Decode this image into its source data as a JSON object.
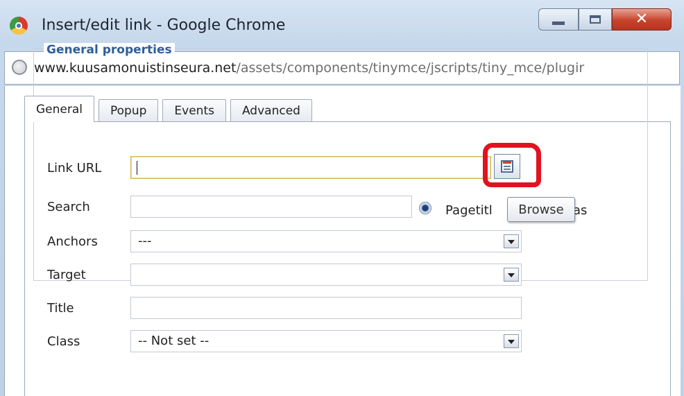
{
  "window": {
    "title": "Insert/edit link - Google Chrome",
    "address": {
      "host": "www.kuusamonuistinseura.net",
      "path": "/assets/components/tinymce/jscripts/tiny_mce/plugir"
    }
  },
  "tabs": [
    {
      "label": "General",
      "active": true
    },
    {
      "label": "Popup",
      "active": false
    },
    {
      "label": "Events",
      "active": false
    },
    {
      "label": "Advanced",
      "active": false
    }
  ],
  "general_properties": {
    "legend": "General properties",
    "link_url": {
      "label": "Link URL",
      "value": ""
    },
    "browse_tooltip": "Browse",
    "search": {
      "label": "Search",
      "value": "",
      "radio_label": "Pagetitl",
      "radio_label_tail": "as"
    },
    "anchors": {
      "label": "Anchors",
      "selected": "---"
    },
    "target": {
      "label": "Target",
      "selected": ""
    },
    "title": {
      "label": "Title",
      "value": ""
    },
    "class": {
      "label": "Class",
      "selected": "-- Not set --"
    }
  },
  "colors": {
    "legend_blue": "#2c5f9a",
    "highlight_red": "#e0131e",
    "close_red": "#c7432b"
  },
  "icons": [
    "chrome-icon",
    "minimize-icon",
    "maximize-icon",
    "close-icon",
    "globe-icon",
    "browse-icon",
    "chevron-down-icon"
  ]
}
